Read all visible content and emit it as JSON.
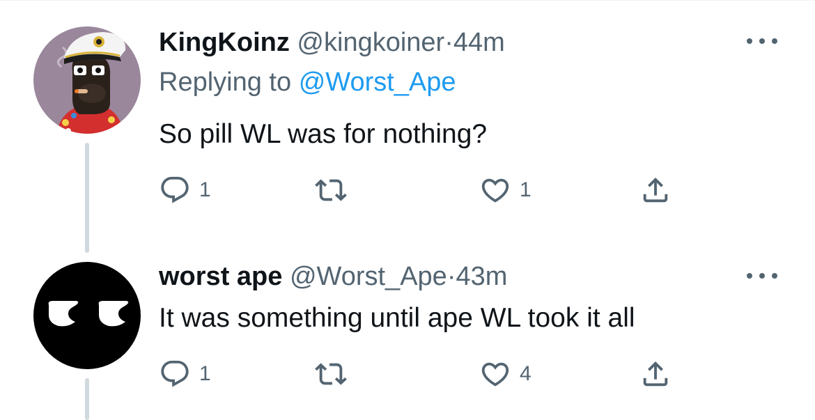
{
  "tweets": [
    {
      "name": "KingKoinz",
      "handle": "@kingkoiner",
      "separator": "·",
      "time": "44m",
      "replying_prefix": "Replying to",
      "replying_to": "@Worst_Ape",
      "text": "So pill WL was for nothing?",
      "replies": "1",
      "likes": "1",
      "avatar_icon": "captain-ape-avatar"
    },
    {
      "name": "worst ape",
      "handle": "@Worst_Ape",
      "separator": "·",
      "time": "43m",
      "text": "It was something until ape WL took it all",
      "replies": "1",
      "likes": "4",
      "avatar_icon": "white-eyes-avatar"
    }
  ],
  "icons": {
    "reply": "reply-icon",
    "retweet": "retweet-icon",
    "like": "heart-icon",
    "share": "share-icon",
    "more": "more-icon"
  },
  "colors": {
    "link": "#1d9bf0",
    "secondary": "#536471",
    "thread_line": "#cfd9de"
  }
}
